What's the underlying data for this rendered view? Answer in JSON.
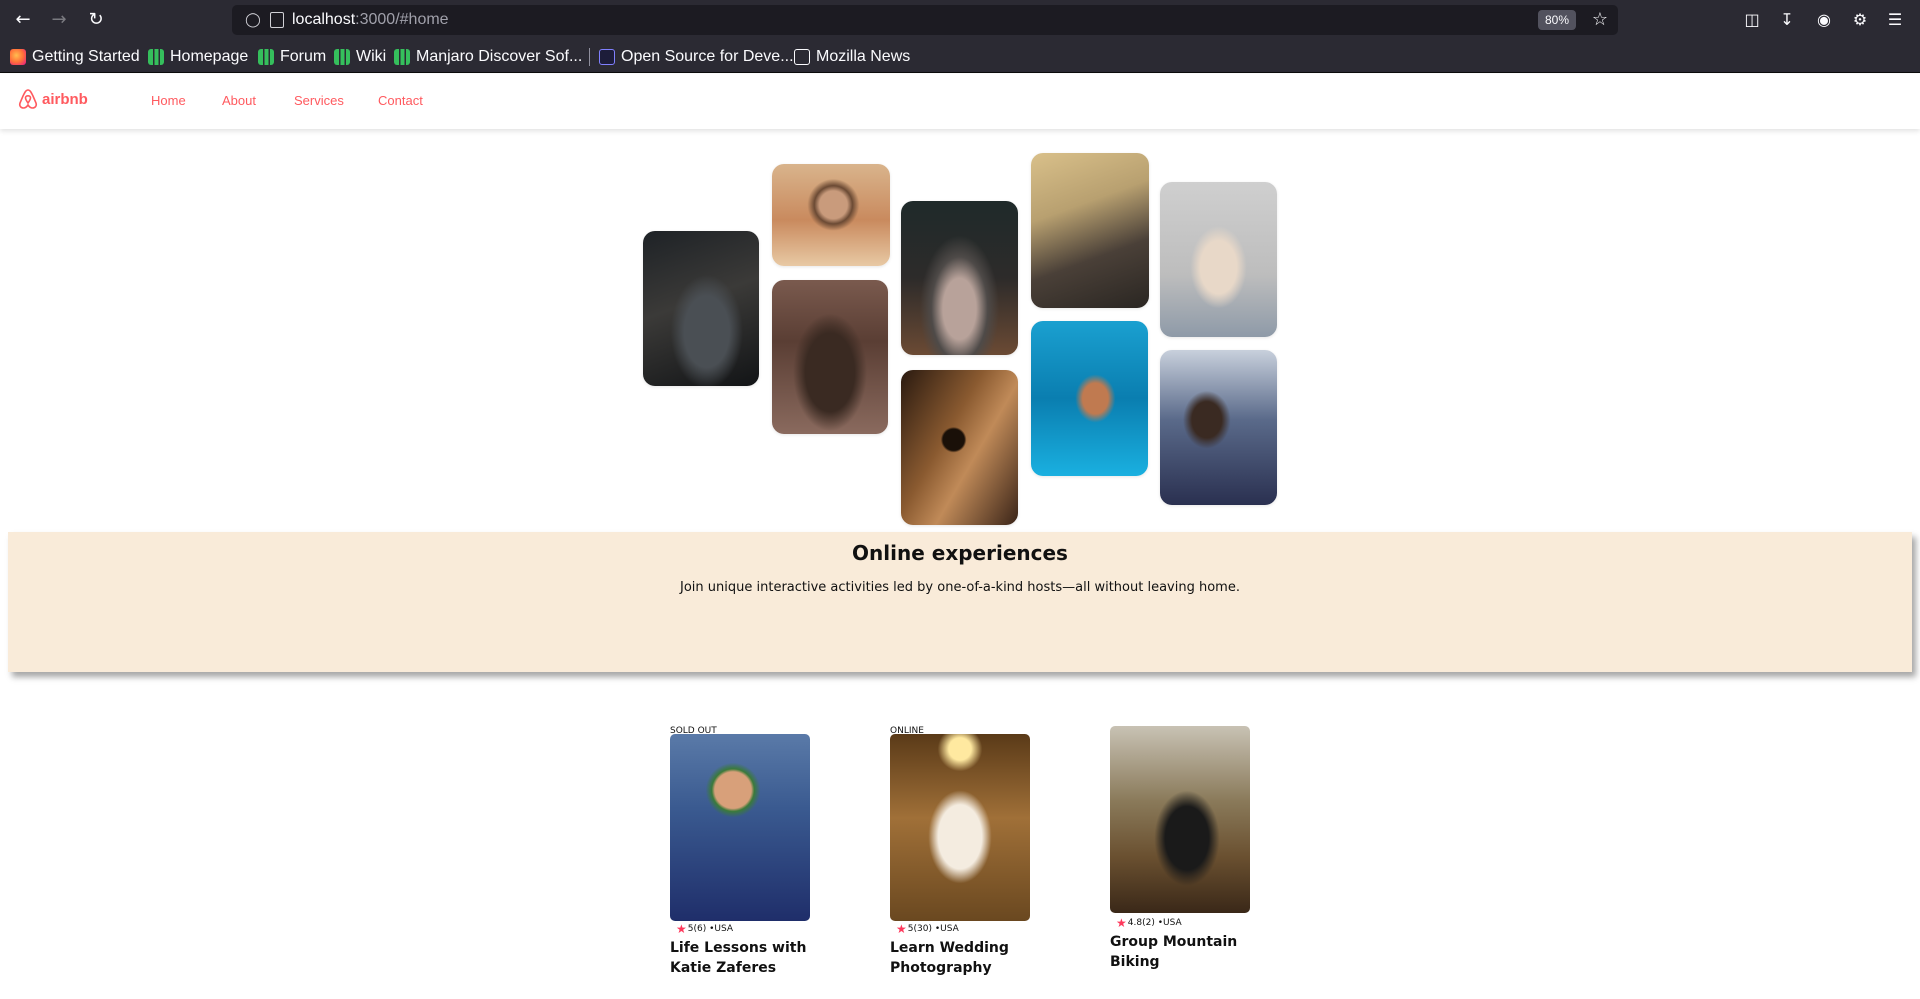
{
  "browser": {
    "url_host": "localhost",
    "url_path": ":3000/#home",
    "zoom": "80%",
    "bookmarks": [
      {
        "label": "Getting Started",
        "icon": "firefox-icon"
      },
      {
        "label": "Homepage",
        "icon": "manjaro-icon"
      },
      {
        "label": "Forum",
        "icon": "manjaro-icon"
      },
      {
        "label": "Wiki",
        "icon": "manjaro-icon"
      },
      {
        "label": "Manjaro Discover Sof...",
        "icon": "manjaro-icon"
      },
      {
        "label": "Open Source for Deve...",
        "icon": "opensource-icon"
      },
      {
        "label": "Mozilla News",
        "icon": "globe-icon"
      }
    ]
  },
  "site": {
    "logo_text": "airbnb",
    "brand_color": "#ff5a5f",
    "nav": [
      "Home",
      "About",
      "Services",
      "Contact"
    ]
  },
  "hero": {
    "title": "Online experiences",
    "subtitle": "Join unique interactive activities led by one-of-a-kind hosts—all without leaving home.",
    "band_color": "#f9ebd9"
  },
  "cards": [
    {
      "badge": "SOLD OUT",
      "rating": "5",
      "reviews": "(6)",
      "location": "•USA",
      "title": "Life Lessons with Katie Zaferes"
    },
    {
      "badge": "ONLINE",
      "rating": "5",
      "reviews": "(30)",
      "location": "•USA",
      "title": "Learn Wedding Photography"
    },
    {
      "badge": "",
      "rating": "4.8",
      "reviews": "(2)",
      "location": "•USA",
      "title": "Group Mountain Biking"
    }
  ]
}
